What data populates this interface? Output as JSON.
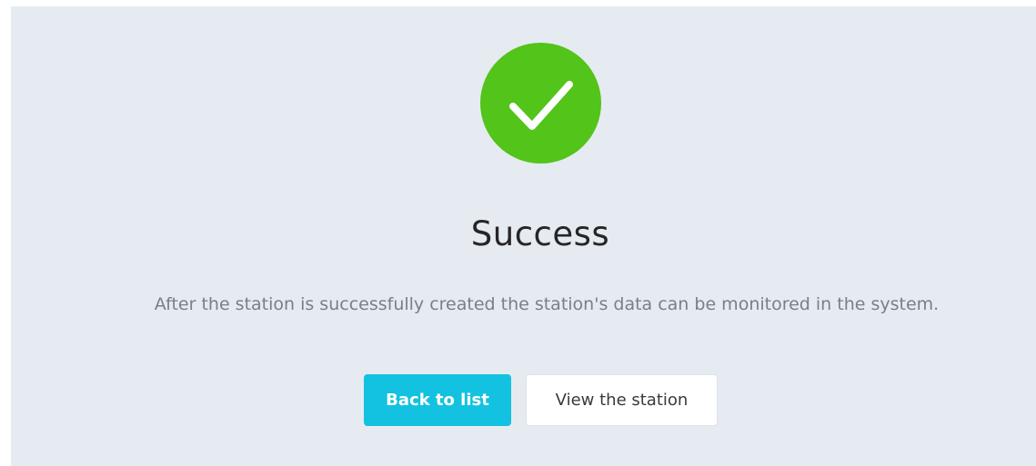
{
  "result": {
    "status": "success",
    "status_color": "#52c41a",
    "icon": "checkmark-icon",
    "title": "Success",
    "subtitle": "After the station is successfully created the station's data can be monitored in the system."
  },
  "actions": {
    "back_label": "Back to list",
    "back_color": "#13c2e0",
    "view_label": "View the station"
  }
}
